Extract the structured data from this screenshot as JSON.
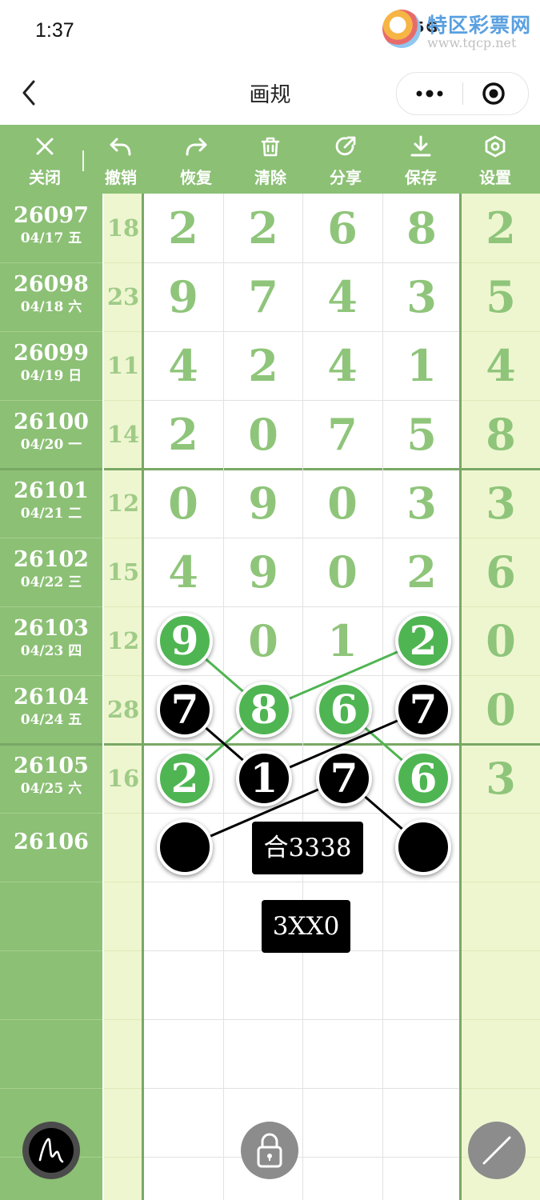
{
  "status": {
    "time": "1:37",
    "signal": "5G"
  },
  "watermark": {
    "title": "特区彩票网",
    "url": "www.tqcp.net"
  },
  "nav": {
    "title": "画规",
    "back_icon": "chevron-left-icon",
    "more_icon": "more-dots-icon",
    "target_icon": "target-icon"
  },
  "toolbar": {
    "items": [
      {
        "label": "关闭",
        "icon": "close-icon"
      },
      {
        "label": "撤销",
        "icon": "undo-icon"
      },
      {
        "label": "恢复",
        "icon": "redo-icon"
      },
      {
        "label": "清除",
        "icon": "trash-icon"
      },
      {
        "label": "分享",
        "icon": "share-icon"
      },
      {
        "label": "保存",
        "icon": "download-icon"
      },
      {
        "label": "设置",
        "icon": "settings-icon"
      }
    ]
  },
  "table": {
    "rows": [
      {
        "issue": "26097",
        "date": "04/17 五",
        "sum": "18",
        "d1": "2",
        "d2": "2",
        "d3": "6",
        "d4": "8",
        "right": "2"
      },
      {
        "issue": "26098",
        "date": "04/18 六",
        "sum": "23",
        "d1": "9",
        "d2": "7",
        "d3": "4",
        "d4": "3",
        "right": "5"
      },
      {
        "issue": "26099",
        "date": "04/19 日",
        "sum": "11",
        "d1": "4",
        "d2": "2",
        "d3": "4",
        "d4": "1",
        "right": "4"
      },
      {
        "issue": "26100",
        "date": "04/20 一",
        "sum": "14",
        "d1": "2",
        "d2": "0",
        "d3": "7",
        "d4": "5",
        "right": "8"
      },
      {
        "issue": "26101",
        "date": "04/21 二",
        "sum": "12",
        "d1": "0",
        "d2": "9",
        "d3": "0",
        "d4": "3",
        "right": "3"
      },
      {
        "issue": "26102",
        "date": "04/22 三",
        "sum": "15",
        "d1": "4",
        "d2": "9",
        "d3": "0",
        "d4": "2",
        "right": "6"
      },
      {
        "issue": "26103",
        "date": "04/23 四",
        "sum": "12",
        "d1": "9",
        "d2": "0",
        "d3": "1",
        "d4": "2",
        "right": "0"
      },
      {
        "issue": "26104",
        "date": "04/24 五",
        "sum": "28",
        "d1": "7",
        "d2": "8",
        "d3": "6",
        "d4": "7",
        "right": "0"
      },
      {
        "issue": "26105",
        "date": "04/25 六",
        "sum": "16",
        "d1": "2",
        "d2": "1",
        "d3": "7",
        "d4": "6",
        "right": "3"
      },
      {
        "issue": "26106",
        "date": "",
        "sum": "",
        "d1": "",
        "d2": "",
        "d3": "",
        "d4": "",
        "right": ""
      }
    ]
  },
  "marks": {
    "balls": [
      {
        "row": 6,
        "col": 1,
        "text": "9",
        "color": "green"
      },
      {
        "row": 6,
        "col": 4,
        "text": "2",
        "color": "green"
      },
      {
        "row": 7,
        "col": 1,
        "text": "7",
        "color": "black"
      },
      {
        "row": 7,
        "col": 2,
        "text": "8",
        "color": "green"
      },
      {
        "row": 7,
        "col": 3,
        "text": "6",
        "color": "green"
      },
      {
        "row": 7,
        "col": 4,
        "text": "7",
        "color": "black"
      },
      {
        "row": 8,
        "col": 1,
        "text": "2",
        "color": "green"
      },
      {
        "row": 8,
        "col": 2,
        "text": "1",
        "color": "black"
      },
      {
        "row": 8,
        "col": 3,
        "text": "7",
        "color": "black"
      },
      {
        "row": 8,
        "col": 4,
        "text": "6",
        "color": "green"
      },
      {
        "row": 9,
        "col": 1,
        "text": "",
        "color": "black"
      },
      {
        "row": 9,
        "col": 4,
        "text": "",
        "color": "black"
      }
    ],
    "label_sum": "合3338",
    "label_pattern": "3XX0"
  },
  "fabs": {
    "draw": "pen-icon",
    "lock": "lock-icon",
    "line": "line-tool-icon"
  },
  "colors": {
    "primary_green": "#8cc075",
    "ball_green": "#4fb552",
    "digit_green": "#8fc57a",
    "pale": "#eef6d0"
  }
}
